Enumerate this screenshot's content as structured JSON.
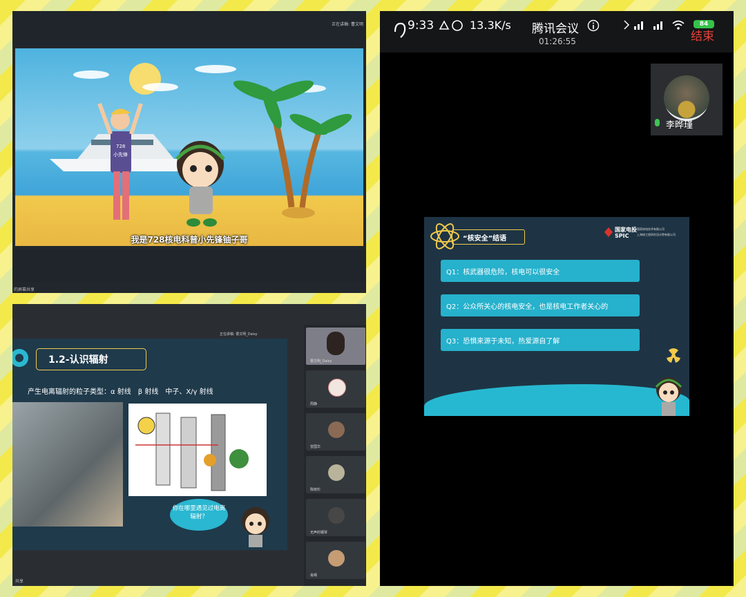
{
  "video_panel": {
    "share_status": "正在讲稿: 曹文明",
    "subtitle": "我是728核电科普小先锋铀子哥",
    "shirt_text_1": "728",
    "shirt_text_2": "小先锋",
    "footer": "的屏幕共享"
  },
  "slide_panel": {
    "share_status": "正在讲稿: 曹文明_Daisy",
    "title": "1.2-认识辐射",
    "particle_types": "产生电离辐射的粒子类型：α 射线　β 射线　中子、X/γ 射线",
    "bubble": "你在哪里遇见过电离辐射？",
    "footer": "共享",
    "participants": [
      {
        "name": "曹文明_Daisy"
      },
      {
        "name": "周静"
      },
      {
        "name": "曾国华"
      },
      {
        "name": "陈晓杉"
      },
      {
        "name": "无声的钢琴"
      },
      {
        "name": "肖晴"
      }
    ]
  },
  "phone_panel": {
    "time": "9:33",
    "net_speed": "13.3K/s",
    "meeting_app": "腾讯会议",
    "elapsed": "01:26:55",
    "battery": "84",
    "end_button": "结束",
    "self_name": "李晔瑾",
    "slide": {
      "title": "“核安全”结语",
      "logo": "国家电投",
      "logo_en": "SPIC",
      "logo_sub1": "国家核电技术有限公司",
      "logo_sub2": "上海核工程研究设计院有限公司",
      "questions": [
        "Q1：核武器很危险，核电可以很安全",
        "Q2：公众所关心的核电安全，也是核电工作者关心的",
        "Q3：恐惧来源于未知，热爱源自了解"
      ]
    }
  },
  "colors": {
    "accent_teal": "#26b1cc",
    "end_red": "#e8413a",
    "highlight_yellow": "#f2c94c"
  }
}
